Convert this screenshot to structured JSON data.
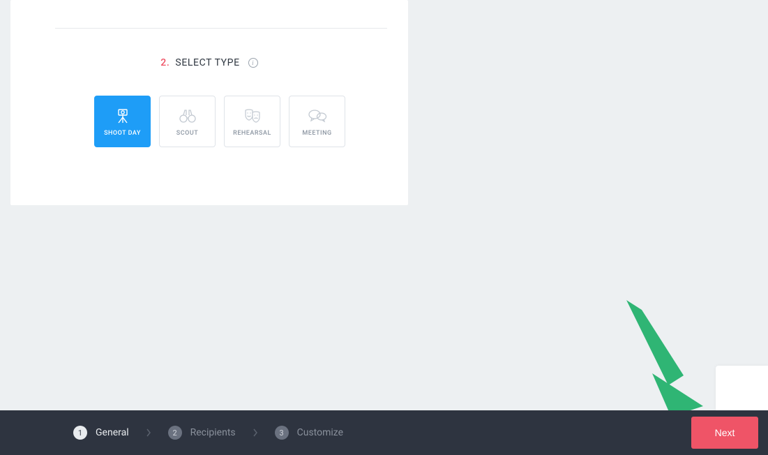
{
  "section": {
    "number": "2.",
    "title": "SELECT TYPE"
  },
  "types": [
    {
      "label": "SHOOT DAY",
      "icon": "camera-tripod",
      "active": true
    },
    {
      "label": "SCOUT",
      "icon": "binoculars",
      "active": false
    },
    {
      "label": "REHEARSAL",
      "icon": "masks",
      "active": false
    },
    {
      "label": "MEETING",
      "icon": "speech-bubbles",
      "active": false
    }
  ],
  "steps": [
    {
      "num": "1",
      "label": "General",
      "active": true
    },
    {
      "num": "2",
      "label": "Recipients",
      "active": false
    },
    {
      "num": "3",
      "label": "Customize",
      "active": false
    }
  ],
  "next_label": "Next",
  "colors": {
    "accent_blue": "#1e9df7",
    "accent_red": "#ef5467",
    "bar_bg": "#2e3440",
    "arrow_green": "#2fb574"
  }
}
